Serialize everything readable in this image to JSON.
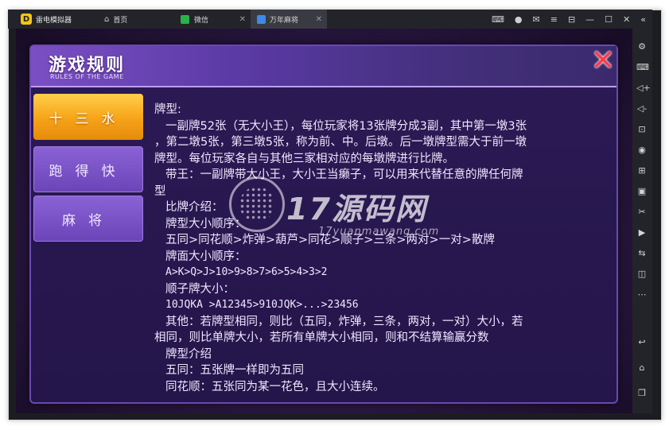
{
  "window": {
    "app_name": "雷电模拟器",
    "tabs": [
      {
        "label": "首页",
        "icon": "home-icon"
      },
      {
        "label": "微信",
        "icon": "wechat-icon"
      },
      {
        "label": "万年麻将",
        "icon": "game-icon",
        "active": true
      }
    ]
  },
  "game": {
    "title": "游戏规则",
    "subtitle": "RULES OF THE GAME",
    "menu": [
      {
        "label": "十三水",
        "active": true
      },
      {
        "label": "跑得快",
        "active": false
      },
      {
        "label": "麻将",
        "active": false
      }
    ],
    "content_lines": [
      "牌型:",
      "一副牌52张（无大小王），每位玩家将13张牌分成3副，其中第一墩3张",
      "，第二墩5张，第三墩5张，称为前、中。后墩。后一墩牌型需大于前一墩",
      "牌型。每位玩家各自与其他三家相对应的每墩牌进行比牌。",
      "带王：一副牌带大小王，大小王当癞子，可以用来代替任意的牌任何牌",
      "型",
      "比牌介绍：",
      "牌型大小顺序：",
      "五同>同花顺>炸弹>葫芦>同花>顺子>三条>两对>一对>散牌",
      "牌面大小顺序：",
      "A>K>Q>J>10>9>8>7>6>5>4>3>2",
      "顺子牌大小：",
      "10JQKA >A12345>910JQK>...>23456",
      "其他：若牌型相同，则比（五同，炸弹，三条，两对，一对）大小，若",
      "相同，则比单牌大小，若所有单牌大小相同，则和不结算输赢分数",
      "牌型介绍",
      "五同：五张牌一样即为五同",
      "同花顺：五张同为某一花色，且大小连续。"
    ]
  },
  "watermark": {
    "main": "17源码网",
    "sub": "17yuanmawang.com"
  }
}
